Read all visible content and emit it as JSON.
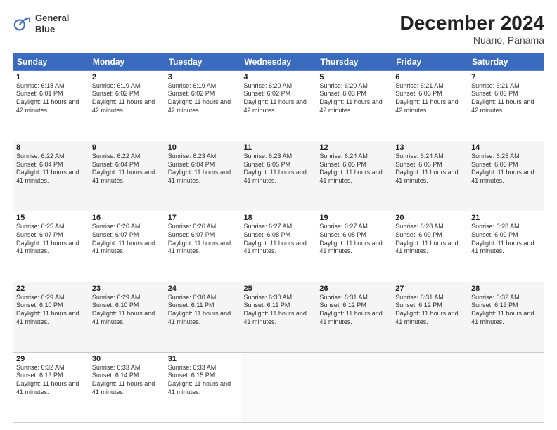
{
  "logo": {
    "line1": "General",
    "line2": "Blue"
  },
  "title": "December 2024",
  "subtitle": "Nuario, Panama",
  "days_of_week": [
    "Sunday",
    "Monday",
    "Tuesday",
    "Wednesday",
    "Thursday",
    "Friday",
    "Saturday"
  ],
  "weeks": [
    [
      {
        "day": 1,
        "sunrise": "6:18 AM",
        "sunset": "6:01 PM",
        "daylight": "11 hours and 42 minutes."
      },
      {
        "day": 2,
        "sunrise": "6:19 AM",
        "sunset": "6:02 PM",
        "daylight": "11 hours and 42 minutes."
      },
      {
        "day": 3,
        "sunrise": "6:19 AM",
        "sunset": "6:02 PM",
        "daylight": "11 hours and 42 minutes."
      },
      {
        "day": 4,
        "sunrise": "6:20 AM",
        "sunset": "6:02 PM",
        "daylight": "11 hours and 42 minutes."
      },
      {
        "day": 5,
        "sunrise": "6:20 AM",
        "sunset": "6:03 PM",
        "daylight": "11 hours and 42 minutes."
      },
      {
        "day": 6,
        "sunrise": "6:21 AM",
        "sunset": "6:03 PM",
        "daylight": "11 hours and 42 minutes."
      },
      {
        "day": 7,
        "sunrise": "6:21 AM",
        "sunset": "6:03 PM",
        "daylight": "11 hours and 42 minutes."
      }
    ],
    [
      {
        "day": 8,
        "sunrise": "6:22 AM",
        "sunset": "6:04 PM",
        "daylight": "11 hours and 41 minutes."
      },
      {
        "day": 9,
        "sunrise": "6:22 AM",
        "sunset": "6:04 PM",
        "daylight": "11 hours and 41 minutes."
      },
      {
        "day": 10,
        "sunrise": "6:23 AM",
        "sunset": "6:04 PM",
        "daylight": "11 hours and 41 minutes."
      },
      {
        "day": 11,
        "sunrise": "6:23 AM",
        "sunset": "6:05 PM",
        "daylight": "11 hours and 41 minutes."
      },
      {
        "day": 12,
        "sunrise": "6:24 AM",
        "sunset": "6:05 PM",
        "daylight": "11 hours and 41 minutes."
      },
      {
        "day": 13,
        "sunrise": "6:24 AM",
        "sunset": "6:06 PM",
        "daylight": "11 hours and 41 minutes."
      },
      {
        "day": 14,
        "sunrise": "6:25 AM",
        "sunset": "6:06 PM",
        "daylight": "11 hours and 41 minutes."
      }
    ],
    [
      {
        "day": 15,
        "sunrise": "6:25 AM",
        "sunset": "6:07 PM",
        "daylight": "11 hours and 41 minutes."
      },
      {
        "day": 16,
        "sunrise": "6:26 AM",
        "sunset": "6:07 PM",
        "daylight": "11 hours and 41 minutes."
      },
      {
        "day": 17,
        "sunrise": "6:26 AM",
        "sunset": "6:07 PM",
        "daylight": "11 hours and 41 minutes."
      },
      {
        "day": 18,
        "sunrise": "6:27 AM",
        "sunset": "6:08 PM",
        "daylight": "11 hours and 41 minutes."
      },
      {
        "day": 19,
        "sunrise": "6:27 AM",
        "sunset": "6:08 PM",
        "daylight": "11 hours and 41 minutes."
      },
      {
        "day": 20,
        "sunrise": "6:28 AM",
        "sunset": "6:09 PM",
        "daylight": "11 hours and 41 minutes."
      },
      {
        "day": 21,
        "sunrise": "6:28 AM",
        "sunset": "6:09 PM",
        "daylight": "11 hours and 41 minutes."
      }
    ],
    [
      {
        "day": 22,
        "sunrise": "6:29 AM",
        "sunset": "6:10 PM",
        "daylight": "11 hours and 41 minutes."
      },
      {
        "day": 23,
        "sunrise": "6:29 AM",
        "sunset": "6:10 PM",
        "daylight": "11 hours and 41 minutes."
      },
      {
        "day": 24,
        "sunrise": "6:30 AM",
        "sunset": "6:11 PM",
        "daylight": "11 hours and 41 minutes."
      },
      {
        "day": 25,
        "sunrise": "6:30 AM",
        "sunset": "6:11 PM",
        "daylight": "11 hours and 41 minutes."
      },
      {
        "day": 26,
        "sunrise": "6:31 AM",
        "sunset": "6:12 PM",
        "daylight": "11 hours and 41 minutes."
      },
      {
        "day": 27,
        "sunrise": "6:31 AM",
        "sunset": "6:12 PM",
        "daylight": "11 hours and 41 minutes."
      },
      {
        "day": 28,
        "sunrise": "6:32 AM",
        "sunset": "6:13 PM",
        "daylight": "11 hours and 41 minutes."
      }
    ],
    [
      {
        "day": 29,
        "sunrise": "6:32 AM",
        "sunset": "6:13 PM",
        "daylight": "11 hours and 41 minutes."
      },
      {
        "day": 30,
        "sunrise": "6:33 AM",
        "sunset": "6:14 PM",
        "daylight": "11 hours and 41 minutes."
      },
      {
        "day": 31,
        "sunrise": "6:33 AM",
        "sunset": "6:15 PM",
        "daylight": "11 hours and 41 minutes."
      },
      null,
      null,
      null,
      null
    ]
  ]
}
